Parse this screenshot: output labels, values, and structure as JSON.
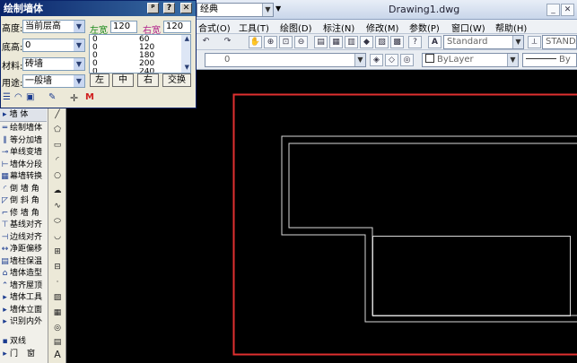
{
  "app": {
    "window_title": "Drawing1.dwg",
    "workspace_combo": "经典",
    "window_controls": [
      "_",
      "✕"
    ]
  },
  "menu": {
    "items": [
      "合式(O)",
      "工具(T)",
      "绘图(D)",
      "标注(N)",
      "修改(M)",
      "参数(P)",
      "窗口(W)",
      "帮助(H)"
    ]
  },
  "toolbar": {
    "text_style": "Standard",
    "dim_style": "STANDA",
    "layer_value": "0",
    "color_value": "ByLayer",
    "linetype_value": "By"
  },
  "dialog": {
    "title": "绘制墙体",
    "title_buttons": [
      "ᵖ",
      "?",
      "✕"
    ],
    "rows": {
      "height_label": "高度:",
      "height_value": "当前层高",
      "base_label": "底高:",
      "base_value": "0",
      "material_label": "材料:",
      "material_value": "砖墙",
      "usage_label": "用途:",
      "usage_value": "一般墙"
    },
    "left_width_label": "左宽",
    "left_width_value": "120",
    "right_width_label": "右宽",
    "right_width_value": "120",
    "width_list": [
      {
        "left": "0",
        "right": "60"
      },
      {
        "left": "0",
        "right": "120"
      },
      {
        "left": "0",
        "right": "180"
      },
      {
        "left": "0",
        "right": "200"
      },
      {
        "left": "0",
        "right": "240"
      }
    ],
    "buttons": {
      "left": "左",
      "center": "中",
      "right": "右",
      "swap": "交换"
    },
    "mode_icon_m": "M"
  },
  "side_panel": {
    "header": "墙  体",
    "items": [
      {
        "label": "绘制墙体",
        "icon": "wall-draw-icon"
      },
      {
        "label": "等分加墙",
        "icon": "equal-wall-icon"
      },
      {
        "label": "单线变墙",
        "icon": "line-to-wall-icon"
      },
      {
        "label": "墙体分段",
        "icon": "split-wall-icon"
      },
      {
        "label": "幕墙转换",
        "icon": "curtain-wall-icon"
      },
      {
        "label": "倒 墙 角",
        "icon": "fillet-icon"
      },
      {
        "label": "倒 斜 角",
        "icon": "chamfer-icon"
      },
      {
        "label": "修 墙 角",
        "icon": "fix-corner-icon"
      },
      {
        "label": "基线对齐",
        "icon": "baseline-align-icon"
      },
      {
        "label": "边线对齐",
        "icon": "edge-align-icon"
      },
      {
        "label": "净距偏移",
        "icon": "offset-icon"
      },
      {
        "label": "墙柱保温",
        "icon": "insulation-icon"
      },
      {
        "label": "墙体造型",
        "icon": "wall-shape-icon"
      },
      {
        "label": "墙齐屋顶",
        "icon": "roof-align-icon"
      },
      {
        "label": "墙体工具",
        "icon": "wall-tools-icon"
      },
      {
        "label": "墙体立面",
        "icon": "wall-elevation-icon"
      },
      {
        "label": "识别内外",
        "icon": "identify-icon"
      }
    ],
    "bottom_items": [
      "双线",
      "门",
      "窗"
    ]
  },
  "colors": {
    "canvas": "#000000",
    "viewport_border": "#e03030",
    "wall_lines": "#d8d8d8"
  }
}
